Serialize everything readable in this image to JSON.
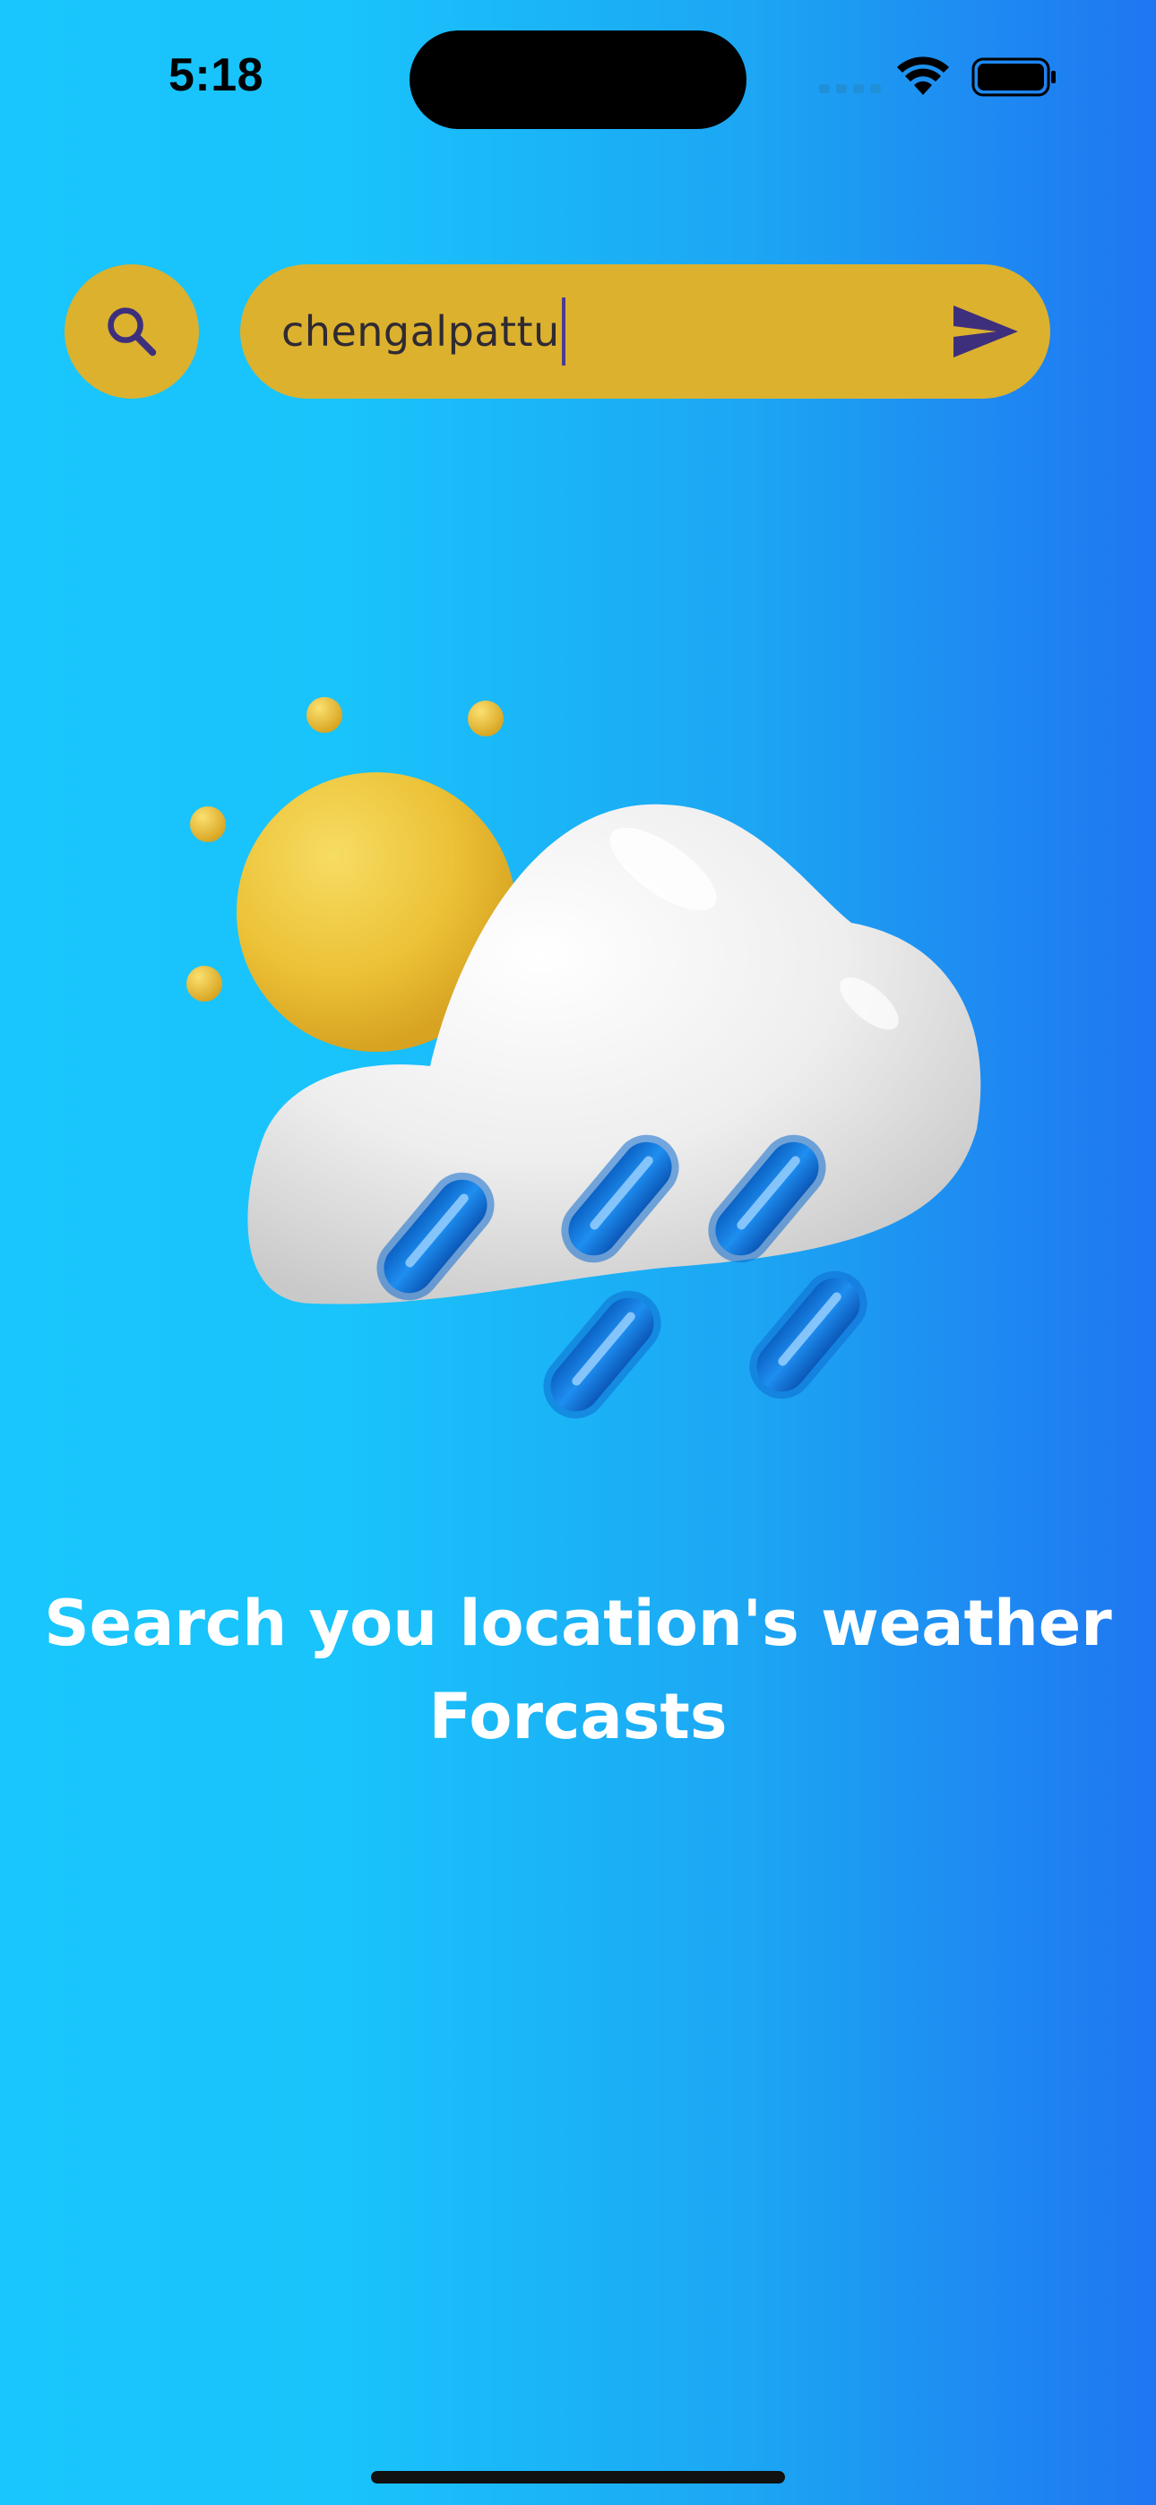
{
  "status_bar": {
    "time": "5:18",
    "icons": [
      "cellular-signal-icon",
      "wifi-icon",
      "battery-icon"
    ]
  },
  "search": {
    "value": "chengalpattu",
    "search_icon": "search-icon",
    "send_icon": "send-icon"
  },
  "illustration": {
    "icon": "sun-cloud-rain-icon"
  },
  "tagline": {
    "line1": "Search you location's weather",
    "line2": "Forcasts"
  },
  "colors": {
    "background_start": "#19c6fd",
    "background_end": "#1f76f1",
    "accent": "#dcb12e",
    "icon": "#3e2f7d",
    "text": "#ffffff"
  }
}
